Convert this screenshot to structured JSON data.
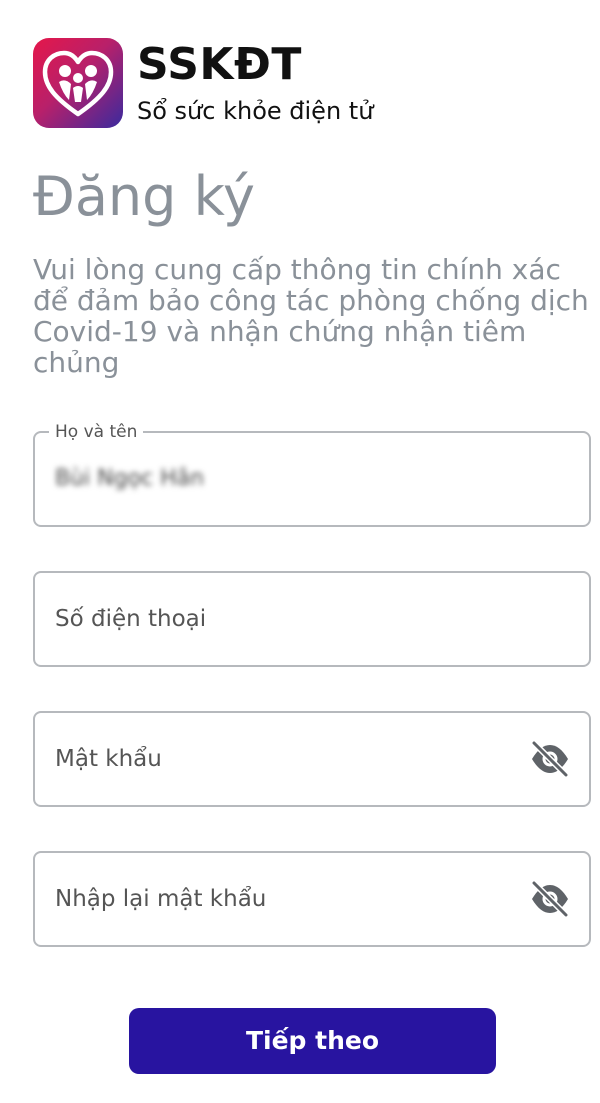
{
  "app": {
    "name": "SSKĐT",
    "tagline": "Sổ sức khỏe điện tử"
  },
  "page": {
    "title": "Đăng ký",
    "description": "Vui lòng cung cấp thông tin chính xác để đảm bảo công tác phòng chống dịch Covid-19 và nhận chứng nhận tiêm chủng"
  },
  "form": {
    "full_name": {
      "label": "Họ và tên",
      "value": "Bùi Ngọc Hân"
    },
    "phone": {
      "placeholder": "Số điện thoại"
    },
    "password": {
      "placeholder": "Mật khẩu",
      "icon": "eye-off-icon"
    },
    "confirm_password": {
      "placeholder": "Nhập lại mật khẩu",
      "icon": "eye-off-icon"
    }
  },
  "actions": {
    "next_label": "Tiếp theo"
  },
  "colors": {
    "primary_button": "#2814a0",
    "muted_text": "#8a9199",
    "logo_gradient_start": "#e5174a",
    "logo_gradient_end": "#3a2a9e"
  }
}
